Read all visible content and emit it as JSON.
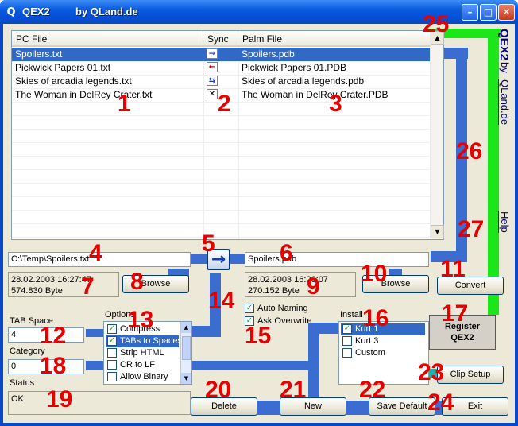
{
  "window": {
    "icon": "q-app-icon",
    "icon_glyph": "Q",
    "title": "QEX2",
    "subtitle": "by QLand.de",
    "minimize_glyph": "–",
    "maximize_glyph": "□",
    "close_glyph": "✕"
  },
  "file_list": {
    "columns": [
      "PC File",
      "Sync",
      "Palm File"
    ],
    "rows": [
      {
        "pc_file": "Spoilers.txt",
        "sync": "⇒",
        "sync_icon": "double-arrow-right-icon",
        "palm_file": "Spoilers.pdb",
        "selected": true
      },
      {
        "pc_file": "Pickwick Papers 01.txt",
        "sync": "←",
        "sync_icon": "arrow-left-icon",
        "palm_file": "Pickwick Papers 01.PDB",
        "selected": false
      },
      {
        "pc_file": "Skies of arcadia legends.txt",
        "sync": "⇆",
        "sync_icon": "arrows-both-icon",
        "palm_file": "Skies of arcadia legends.pdb",
        "selected": false
      },
      {
        "pc_file": "The Woman in DelRey Crater.txt",
        "sync": "✕",
        "sync_icon": "cross-icon",
        "palm_file": "The Woman in DelRey Crater.PDB",
        "selected": false
      }
    ],
    "scroll_up": "▲",
    "scroll_down": "▼"
  },
  "pc_path": "C:\\Temp\\Spoilers.txt",
  "pc_info": {
    "date": "28.02.2003 16:27:47",
    "size": "574.830 Byte"
  },
  "transfer_arrow": "→",
  "palm_name": "Spoilers.pdb",
  "palm_info": {
    "date": "28.02.2003 16:26:07",
    "size": "270.152 Byte"
  },
  "buttons": {
    "browse_pc": "Browse",
    "browse_palm": "Browse",
    "convert": "Convert",
    "register_line1": "Register",
    "register_line2": "QEX2",
    "clip_setup": "Clip Setup",
    "delete": "Delete",
    "new": "New",
    "save_default": "Save Default",
    "exit": "Exit"
  },
  "tab_space": {
    "label": "TAB Space",
    "value": "4"
  },
  "category": {
    "label": "Category",
    "value": "0"
  },
  "status": {
    "label": "Status",
    "value": "OK"
  },
  "options": {
    "label": "Options",
    "items": [
      {
        "label": "Compress",
        "checked": true,
        "selected": false
      },
      {
        "label": "TABs to Spaces",
        "checked": true,
        "selected": true
      },
      {
        "label": "Strip HTML",
        "checked": false,
        "selected": false
      },
      {
        "label": "CR to LF",
        "checked": false,
        "selected": false
      },
      {
        "label": "Allow Binary",
        "checked": false,
        "selected": false
      }
    ]
  },
  "naming": {
    "auto_naming": {
      "label": "Auto Naming",
      "checked": true
    },
    "ask_overwrite": {
      "label": "Ask Overwrite",
      "checked": true
    }
  },
  "install": {
    "label": "Install",
    "items": [
      {
        "label": "Kurt 1",
        "checked": true,
        "selected": true
      },
      {
        "label": "Kurt 3",
        "checked": false,
        "selected": false
      },
      {
        "label": "Custom",
        "checked": false,
        "selected": false
      }
    ]
  },
  "sidebar": {
    "brand": "QEX2",
    "by": "by",
    "site": "QLand.de",
    "help": "Help"
  },
  "check_glyph": "✓",
  "callouts": [
    "1",
    "2",
    "3",
    "4",
    "5",
    "6",
    "7",
    "8",
    "9",
    "10",
    "11",
    "12",
    "13",
    "14",
    "15",
    "16",
    "17",
    "18",
    "19",
    "20",
    "21",
    "22",
    "23",
    "24",
    "25",
    "26",
    "27"
  ],
  "colors": {
    "callout": "#e80000",
    "connector": "#3b6ccf",
    "highlight": "#1ae61a",
    "selection": "#316ac5"
  }
}
